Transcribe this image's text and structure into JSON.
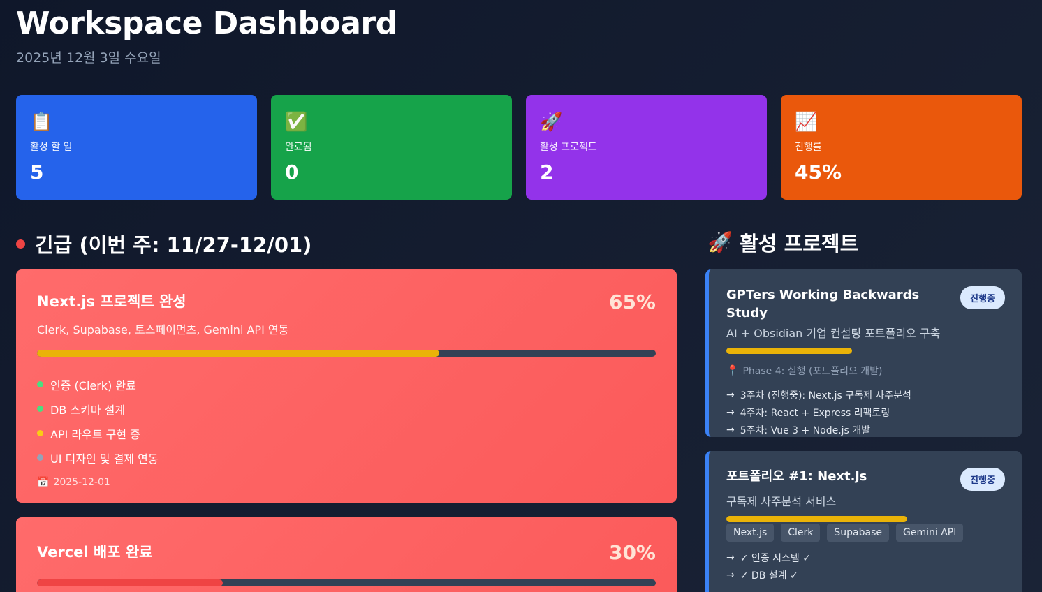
{
  "header": {
    "title": "Workspace Dashboard",
    "date": "2025년 12월 3일 수요일"
  },
  "stats": [
    {
      "icon": "clipboard-icon",
      "glyph": "📋",
      "label": "활성 할 일",
      "value": "5",
      "color": "#2563eb"
    },
    {
      "icon": "check-icon",
      "glyph": "✅",
      "label": "완료됨",
      "value": "0",
      "color": "#16a34a"
    },
    {
      "icon": "rocket-icon",
      "glyph": "🚀",
      "label": "활성 프로젝트",
      "value": "2",
      "color": "#9333ea"
    },
    {
      "icon": "chart-up-icon",
      "glyph": "📈",
      "label": "진행률",
      "value": "45%",
      "color": "#ea580c"
    }
  ],
  "urgent": {
    "title": "긴급 (이번 주: 11/27-12/01)",
    "cards": [
      {
        "title": "Next.js 프로젝트 완성",
        "percent": "65%",
        "progress": 0.65,
        "bar_color": "#eab308",
        "description": "Clerk, Supabase, 토스페이먼츠, Gemini API 연동",
        "items": [
          {
            "label": "인증 (Clerk) 완료",
            "status_color": "#4ade80"
          },
          {
            "label": "DB 스키마 설계",
            "status_color": "#4ade80"
          },
          {
            "label": "API 라우트 구현 중",
            "status_color": "#facc15"
          },
          {
            "label": "UI 디자인 및 결제 연동",
            "status_color": "#94a3b8"
          }
        ],
        "date": "2025-12-01"
      },
      {
        "title": "Vercel 배포 완료",
        "percent": "30%",
        "progress": 0.3,
        "bar_color": "#ef4444"
      }
    ]
  },
  "projects": {
    "title": "활성 프로젝트",
    "cards": [
      {
        "title": "GPTers Working Backwards Study",
        "badge": "진행중",
        "subtitle": "AI + Obsidian 기업 컨설팅 포트폴리오 구축",
        "progress": 0.45,
        "phase": "Phase 4: 실행 (포트폴리오 개발)",
        "steps": [
          "3주차 (진행중): Next.js 구독제 사주분석",
          "4주차: React + Express 리팩토링",
          "5주차: Vue 3 + Node.js 개발"
        ]
      },
      {
        "title": "포트폴리오 #1: Next.js",
        "badge": "진행중",
        "subtitle": "구독제 사주분석 서비스",
        "progress": 0.65,
        "tags": [
          "Next.js",
          "Clerk",
          "Supabase",
          "Gemini API"
        ],
        "steps": [
          "✓ 인증 시스템 ✓",
          "✓ DB 설계 ✓"
        ]
      }
    ]
  }
}
